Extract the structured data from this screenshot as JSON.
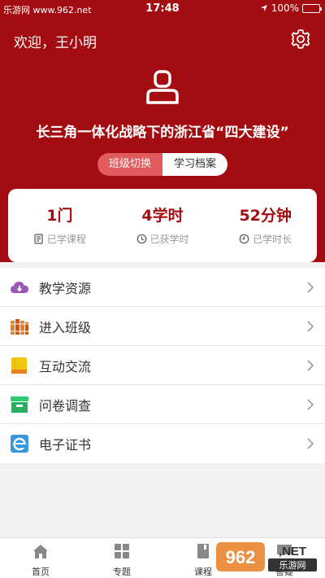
{
  "status_bar": {
    "watermark": "乐游网 www.962.net",
    "time": "17:48",
    "battery": "100%"
  },
  "header": {
    "greeting": "欢迎，王小明",
    "program_title": "长三角一体化战略下的浙江省“四大建设”",
    "toggle": [
      "班级切换",
      "学习档案"
    ]
  },
  "stats": [
    {
      "value": "1门",
      "label": "已学课程",
      "icon": "document-icon"
    },
    {
      "value": "4学时",
      "label": "已获学时",
      "icon": "clock-icon"
    },
    {
      "value": "52分钟",
      "label": "已学时长",
      "icon": "timer-icon"
    }
  ],
  "menu": [
    {
      "label": "教学资源",
      "icon": "cloud-download-icon",
      "color": "#9b59b6"
    },
    {
      "label": "进入班级",
      "icon": "books-icon",
      "color": "#e67e22"
    },
    {
      "label": "互动交流",
      "icon": "book-icon",
      "color": "#f1c40f"
    },
    {
      "label": "问卷调查",
      "icon": "archive-icon",
      "color": "#2ecc71"
    },
    {
      "label": "电子证书",
      "icon": "browser-icon",
      "color": "#3498db"
    }
  ],
  "tabbar": [
    "首页",
    "专题",
    "课程",
    "答疑"
  ],
  "watermark_logo": "962.NET 乐游网",
  "colors": {
    "brand": "#a30d12"
  }
}
